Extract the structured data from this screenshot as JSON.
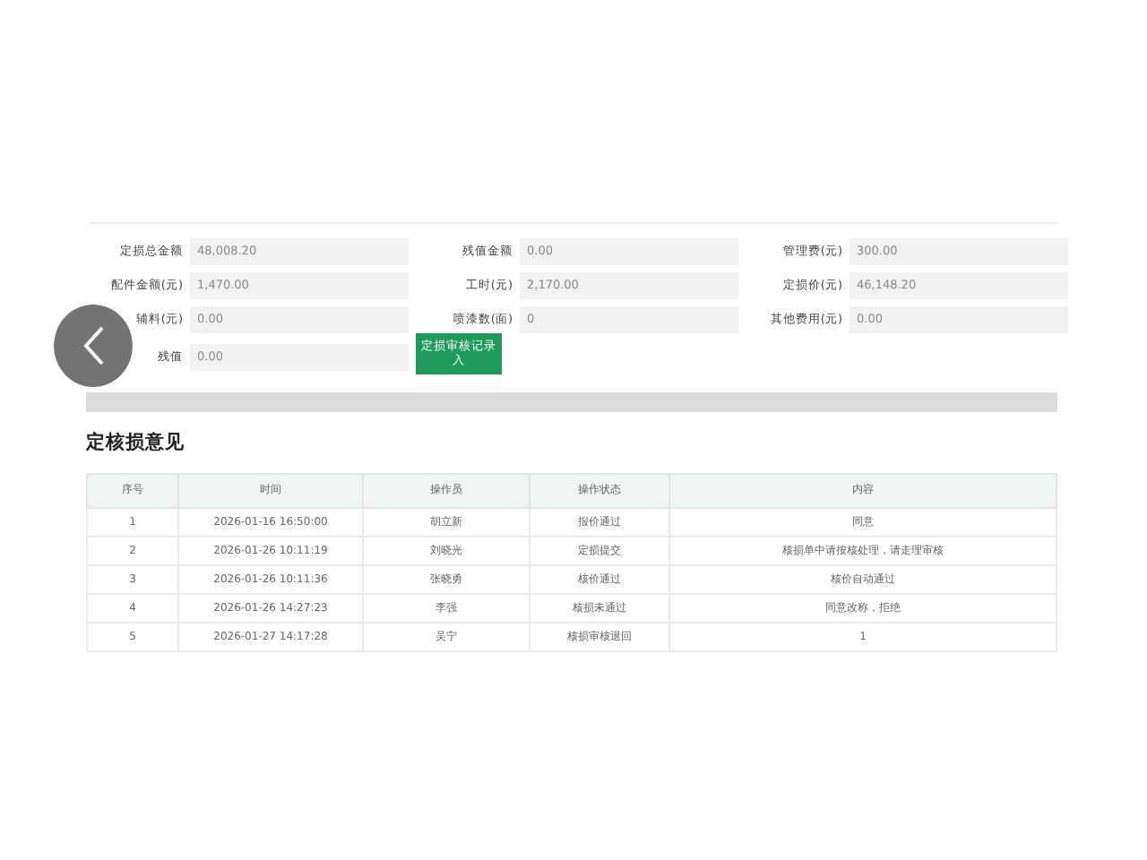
{
  "fields": [
    {
      "label": "定损总金额",
      "value": "48,008.20"
    },
    {
      "label": "残值金额",
      "value": "0.00"
    },
    {
      "label": "管理费(元)",
      "value": "300.00"
    },
    {
      "label": "配件金额(元)",
      "value": "1,470.00"
    },
    {
      "label": "工时(元)",
      "value": "2,170.00"
    },
    {
      "label": "定损价(元)",
      "value": "46,148.20"
    },
    {
      "label": "辅料(元)",
      "value": "0.00"
    },
    {
      "label": "喷漆数(面)",
      "value": "0"
    },
    {
      "label": "其他费用(元)",
      "value": "0.00"
    },
    {
      "label": "残值",
      "value": "0.00"
    }
  ],
  "record_button": "定损审核记录入",
  "section_title": "定核损意见",
  "table": {
    "columns": [
      "序号",
      "时间",
      "操作员",
      "操作状态",
      "内容"
    ],
    "rows": [
      [
        "1",
        "2026-01-16 16:50:00",
        "胡立新",
        "报价通过",
        "同意"
      ],
      [
        "2",
        "2026-01-26 10:11:19",
        "刘晓光",
        "定损提交",
        "核损单中请按核处理，请走理审核"
      ],
      [
        "3",
        "2026-01-26 10:11:36",
        "张晓勇",
        "核价通过",
        "核价自动通过"
      ],
      [
        "4",
        "2026-01-26 14:27:23",
        "李强",
        "核损未通过",
        "同意改称，拒绝"
      ],
      [
        "5",
        "2026-01-27 14:17:28",
        "吴宁",
        "核损审核退回",
        "1"
      ]
    ]
  }
}
